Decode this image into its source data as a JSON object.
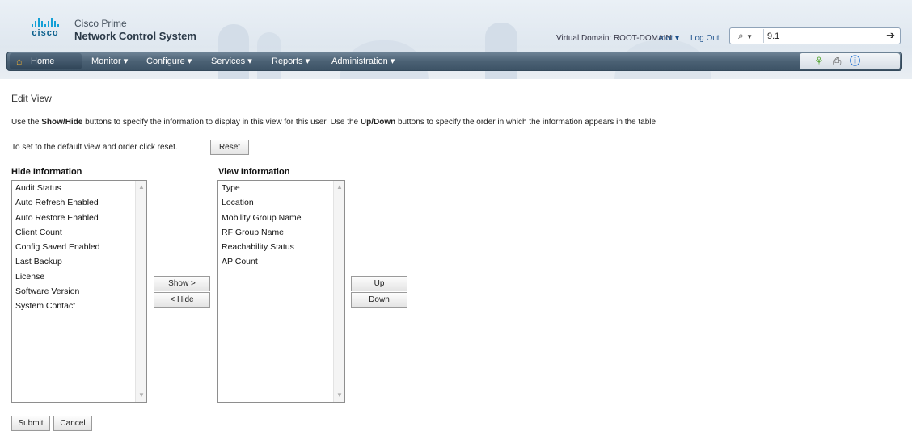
{
  "header": {
    "logo_text": "cisco",
    "brand_line1": "Cisco Prime",
    "brand_line2": "Network Control System",
    "virtual_domain": "Virtual Domain: ROOT-DOMAIN",
    "user_menu": "root ▾",
    "logout": "Log Out",
    "search_icon": "magnifier-icon",
    "search_value": "9.1",
    "go_icon": "arrow-right-icon"
  },
  "nav": {
    "home": "Home",
    "items": [
      "Monitor ▾",
      "Configure ▾",
      "Services ▾",
      "Reports ▾",
      "Administration ▾"
    ],
    "tools": [
      "shield-icon",
      "print-icon",
      "help-icon"
    ]
  },
  "page": {
    "title": "Edit View",
    "instructions": {
      "p1": "Use the ",
      "b1": "Show/Hide",
      "p2": " buttons to specify the information to display in this view for this user. Use the ",
      "b2": "Up/Down",
      "p3": " buttons to specify the order in which the information appears in the table."
    },
    "reset_text": "To set to the default view and order click reset.",
    "reset_button": "Reset"
  },
  "hide_list": {
    "label": "Hide Information",
    "items": [
      "Audit Status",
      "Auto Refresh Enabled",
      "Auto Restore Enabled",
      "Client Count",
      "Config Saved Enabled",
      "Last Backup",
      "License",
      "Software Version",
      "System Contact"
    ]
  },
  "view_list": {
    "label": "View Information",
    "items": [
      "Type",
      "Location",
      "Mobility Group Name",
      "RF Group Name",
      "Reachability Status",
      "AP Count"
    ]
  },
  "buttons": {
    "show": "Show >",
    "hide": "< Hide",
    "up": "Up",
    "down": "Down",
    "submit": "Submit",
    "cancel": "Cancel"
  },
  "colors": {
    "nav_bar": "#4b6174",
    "link": "#1a4f8a",
    "cisco_blue": "#14a0d6"
  }
}
